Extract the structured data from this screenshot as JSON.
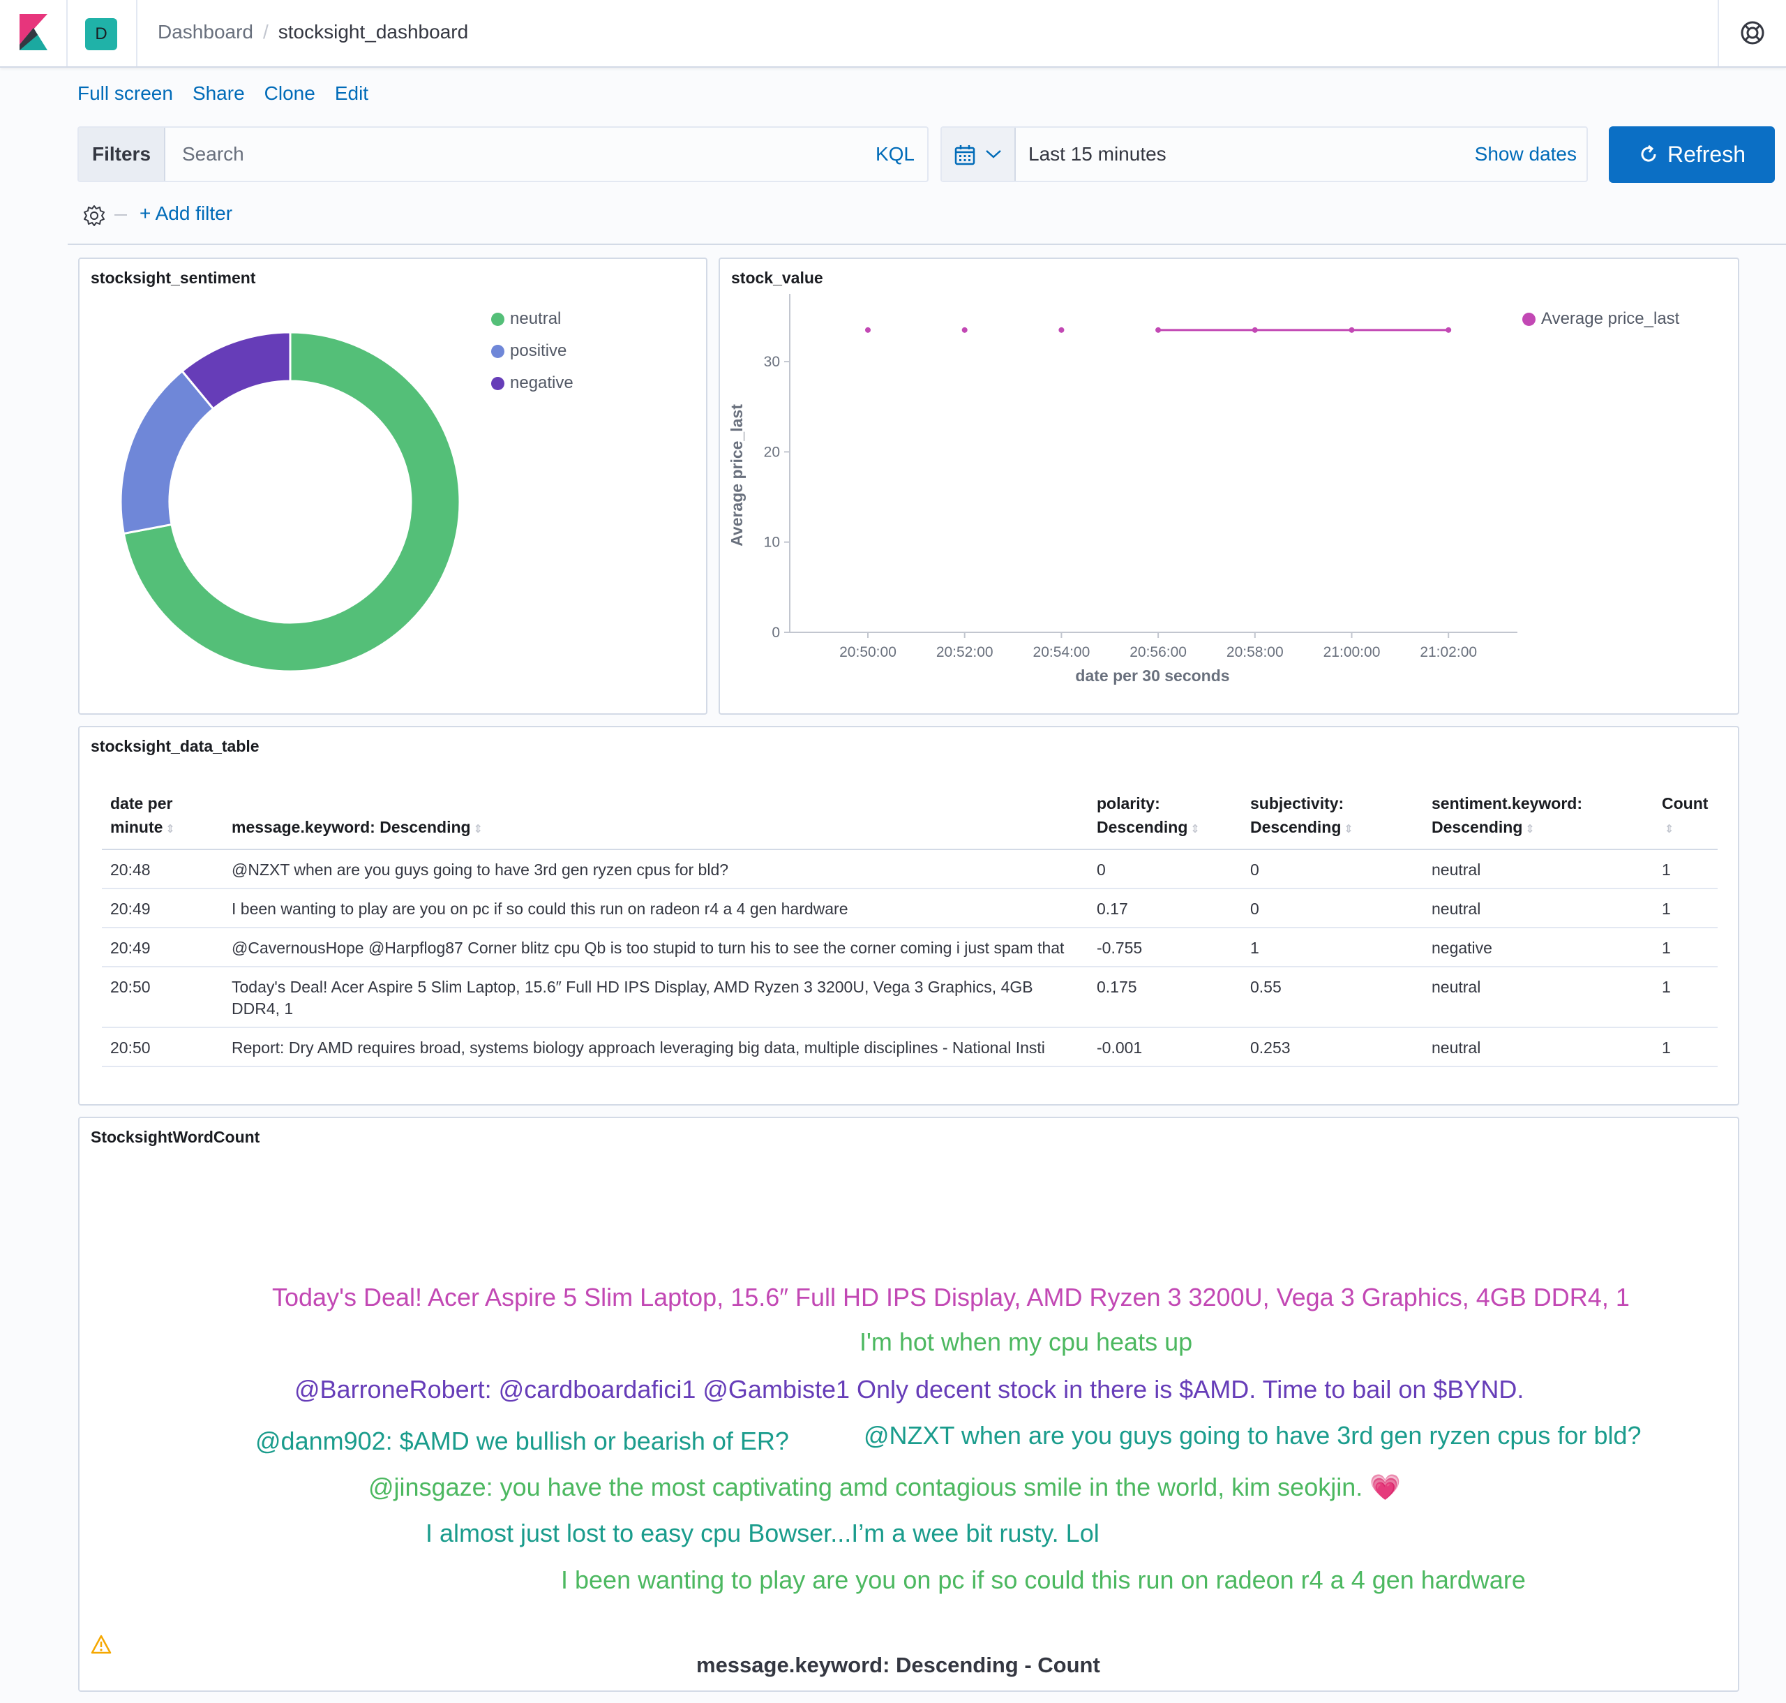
{
  "header": {
    "space_initial": "D",
    "breadcrumb_root": "Dashboard",
    "breadcrumb_separator": "/",
    "breadcrumb_current": "stocksight_dashboard"
  },
  "topnav": {
    "full_screen": "Full screen",
    "share": "Share",
    "clone": "Clone",
    "edit": "Edit"
  },
  "querybar": {
    "filters_label": "Filters",
    "search_placeholder": "Search",
    "kql_label": "KQL",
    "time_range": "Last 15 minutes",
    "show_dates": "Show dates",
    "refresh_label": "Refresh",
    "add_filter": "+ Add filter"
  },
  "colors": {
    "accent": "#006bb8",
    "refresh": "#0b6fc5",
    "neutral": "#54bf78",
    "positive": "#6f87d8",
    "negative": "#663db8",
    "line": "#c248b4",
    "teal": "#1a9c8c",
    "green": "#4cb860"
  },
  "sentiment_panel": {
    "title": "stocksight_sentiment",
    "legend": [
      "neutral",
      "positive",
      "negative"
    ]
  },
  "stock_panel": {
    "title": "stock_value",
    "legend": "Average price_last"
  },
  "chart_data": [
    {
      "type": "pie",
      "donut": true,
      "title": "stocksight_sentiment",
      "categories": [
        "neutral",
        "positive",
        "negative"
      ],
      "values": [
        72,
        17,
        11
      ],
      "colors": [
        "#54bf78",
        "#6f87d8",
        "#663db8"
      ],
      "legend_position": "top-right"
    },
    {
      "type": "line",
      "title": "stock_value",
      "xlabel": "date per 30 seconds",
      "ylabel": "Average price_last",
      "ylim": [
        0,
        35
      ],
      "yticks": [
        0,
        10,
        20,
        30
      ],
      "xticks": [
        "20:50:00",
        "20:52:00",
        "20:54:00",
        "20:56:00",
        "20:58:00",
        "21:00:00",
        "21:02:00"
      ],
      "series": [
        {
          "name": "Average price_last",
          "x": [
            "20:50:00",
            "20:52:00",
            "20:54:00",
            "20:56:00",
            "20:58:00",
            "21:00:00",
            "21:02:00"
          ],
          "y": [
            33.5,
            33.5,
            33.5,
            33.5,
            33.5,
            33.5,
            33.5
          ],
          "connected_from_index": 3,
          "color": "#c248b4"
        }
      ],
      "legend_position": "top-right",
      "grid": false
    }
  ],
  "table_panel": {
    "title": "stocksight_data_table",
    "columns": [
      {
        "line1": "date per",
        "line2": "minute"
      },
      {
        "line1": "",
        "line2": "message.keyword: Descending"
      },
      {
        "line1": "polarity:",
        "line2": "Descending"
      },
      {
        "line1": "subjectivity:",
        "line2": "Descending"
      },
      {
        "line1": "sentiment.keyword:",
        "line2": "Descending"
      },
      {
        "line1": "Count",
        "line2": ""
      }
    ],
    "rows": [
      [
        "20:48",
        "@NZXT when are you guys going to have 3rd gen ryzen cpus for bld?",
        "0",
        "0",
        "neutral",
        "1"
      ],
      [
        "20:49",
        "I been wanting to play are you on pc if so could this run on radeon r4 a 4 gen hardware",
        "0.17",
        "0",
        "neutral",
        "1"
      ],
      [
        "20:49",
        "@CavernousHope @Harpflog87 Corner blitz cpu Qb is too stupid to turn his to see the corner coming i just spam that",
        "-0.755",
        "1",
        "negative",
        "1"
      ],
      [
        "20:50",
        "Today's Deal! Acer Aspire 5 Slim Laptop, 15.6″ Full HD IPS Display, AMD Ryzen 3 3200U, Vega 3 Graphics, 4GB DDR4, 1",
        "0.175",
        "0.55",
        "neutral",
        "1"
      ],
      [
        "20:50",
        "Report: Dry AMD requires broad, systems biology approach leveraging big data, multiple disciplines - National Insti",
        "-0.001",
        "0.253",
        "neutral",
        "1"
      ]
    ]
  },
  "wordcloud_panel": {
    "title": "StocksightWordCount",
    "footer": "message.keyword: Descending - Count",
    "words": [
      {
        "text": "Today's Deal! Acer Aspire 5 Slim Laptop, 15.6″ Full HD IPS Display, AMD Ryzen 3 3200U, Vega 3 Graphics, 4GB DDR4, 1",
        "color": "#c248b4"
      },
      {
        "text": "I'm hot when my cpu heats up",
        "color": "#4cb860"
      },
      {
        "text": "@BarroneRobert: @cardboardafici1 @Gambiste1 Only decent stock in there is $AMD. Time to bail on $BYND.",
        "color": "#663db8"
      },
      {
        "text": "@danm902: $AMD we bullish or bearish of ER?",
        "color": "#1a9c8c"
      },
      {
        "text": "@NZXT when are you guys going to have 3rd gen ryzen cpus for bld?",
        "color": "#1a9c8c"
      },
      {
        "text": "@jinsgaze: you have the most captivating amd contagious smile in the world, kim seokjin. 💗",
        "color": "#4cb860"
      },
      {
        "text": "I almost just lost to easy cpu Bowser...I’m a wee bit rusty. Lol",
        "color": "#1a9c8c"
      },
      {
        "text": "I been wanting to play are you on pc if so could this run on radeon r4 a 4 gen hardware",
        "color": "#4cb860"
      }
    ]
  }
}
